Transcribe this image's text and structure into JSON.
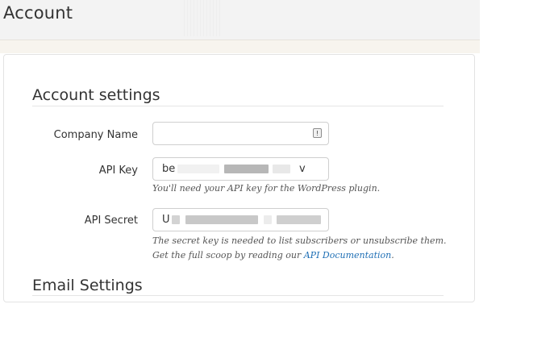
{
  "header": {
    "title": "Account"
  },
  "sections": {
    "account_settings": {
      "title": "Account settings"
    },
    "email_settings": {
      "title": "Email Settings"
    }
  },
  "fields": {
    "company_name": {
      "label": "Company Name",
      "value": ""
    },
    "api_key": {
      "label": "API Key",
      "value_prefix": "be",
      "value_suffix": "v",
      "help": "You'll need your API key for the WordPress plugin."
    },
    "api_secret": {
      "label": "API Secret",
      "value_prefix": "U",
      "value_suffix": "",
      "help_line1": "The secret key is needed to list subscribers or unsubscribe them.",
      "help_line2_prefix": "Get the full scoop by reading our ",
      "help_line2_link": "API Documentation",
      "help_line2_suffix": "."
    }
  },
  "colors": {
    "link": "#1f6fb5",
    "header_bg": "#f3f3f3",
    "border": "#cfcfcf"
  },
  "icons": {
    "company_name_field_icon": "warning-icon"
  }
}
